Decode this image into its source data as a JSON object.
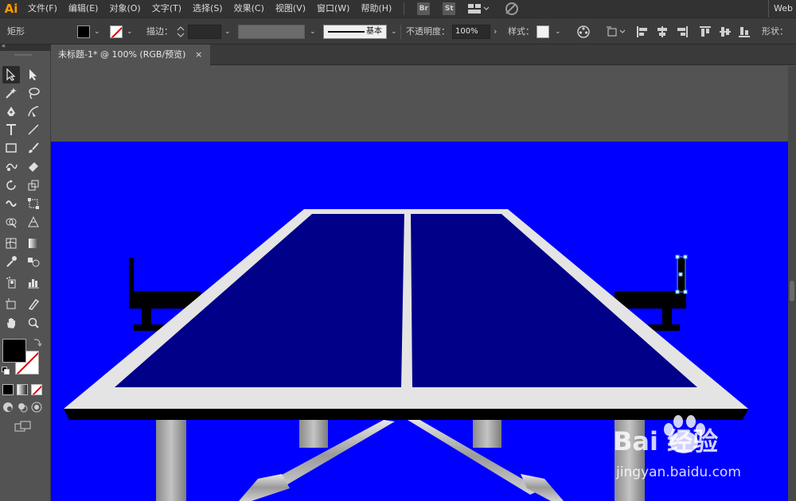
{
  "app": {
    "logo": "Ai",
    "workspace": "Web"
  },
  "menu": [
    "文件(F)",
    "编辑(E)",
    "对象(O)",
    "文字(T)",
    "选择(S)",
    "效果(C)",
    "视图(V)",
    "窗口(W)",
    "帮助(H)"
  ],
  "bridge_buttons": [
    "Br",
    "St"
  ],
  "control_bar": {
    "object_type": "矩形",
    "stroke_label": "描边：",
    "stroke_style": "基本",
    "opacity_label": "不透明度：",
    "opacity_value": "100%",
    "style_label": "样式：",
    "shape_label": "形状："
  },
  "document": {
    "tab_title": "未标题-1* @ 100% (RGB/预览)",
    "close_glyph": "×"
  },
  "colors": {
    "artboard_background": "#0000ff",
    "table_surface": "#000088",
    "table_border": "#e4e4e4",
    "ui_accent": "#ff9a00"
  },
  "icons": {
    "tools": [
      "selection-tool-icon",
      "direct-selection-tool-icon",
      "magic-wand-tool-icon",
      "lasso-tool-icon",
      "pen-tool-icon",
      "curvature-tool-icon",
      "type-tool-icon",
      "line-segment-tool-icon",
      "rectangle-tool-icon",
      "paintbrush-tool-icon",
      "shaper-tool-icon",
      "eraser-tool-icon",
      "rotate-tool-icon",
      "scale-tool-icon",
      "warp-tool-icon",
      "free-transform-tool-icon",
      "shape-builder-tool-icon",
      "perspective-grid-tool-icon",
      "mesh-tool-icon",
      "gradient-tool-icon",
      "eyedropper-tool-icon",
      "blend-tool-icon",
      "symbol-sprayer-tool-icon",
      "column-graph-tool-icon",
      "artboard-tool-icon",
      "slice-tool-icon",
      "hand-tool-icon",
      "zoom-tool-icon"
    ]
  },
  "watermark": {
    "brand": "Bai 经验",
    "url": "jingyan.baidu.com"
  }
}
